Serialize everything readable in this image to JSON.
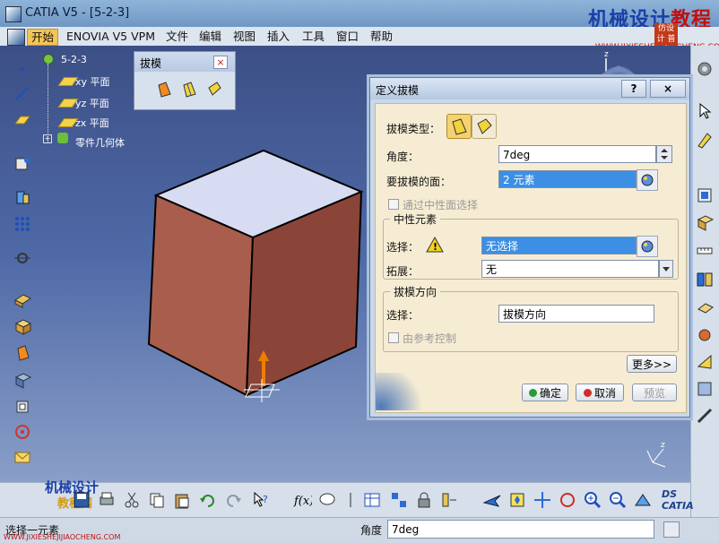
{
  "window": {
    "title": "CATIA V5 - [5-2-3]"
  },
  "watermark": {
    "brand": "机械设计",
    "brand2": "教程网",
    "url": "WWW.JIXIESHEJIJIAOCHENG.COM",
    "stamp": "仿设计\n普大",
    "bottom_brand": "机械设计",
    "bottom_brand2": "教程网",
    "bottom_url": "WWW.JIXIESHEJIJIAOCHENG.COM"
  },
  "menu": {
    "items": [
      "开始",
      "ENOVIA V5 VPM",
      "文件",
      "编辑",
      "视图",
      "插入",
      "工具",
      "窗口",
      "帮助"
    ]
  },
  "tree": {
    "root": "5-2-3",
    "items": [
      "xy 平面",
      "yz 平面",
      "zx 平面",
      "零件几何体"
    ]
  },
  "float_toolbar": {
    "title": "拔模",
    "close": "×"
  },
  "dialog": {
    "title": "定义拔模",
    "help": "?",
    "close": "×",
    "draft_type_label": "拔模类型：",
    "angle_label": "角度：",
    "angle_value": "7deg",
    "faces_label": "要拔模的面：",
    "faces_value": "2 元素",
    "neutral_check": "通过中性面选择",
    "neutral_group": "中性元素",
    "select_label": "选择：",
    "select_value": "无选择",
    "propagation_label": "拓展：",
    "propagation_value": "无",
    "direction_group": "拔模方向",
    "direction_select_label": "选择：",
    "direction_value": "拔模方向",
    "ref_control": "由参考控制",
    "more_button": "更多>>",
    "ok_button": "确定",
    "cancel_button": "取消",
    "preview_button": "预览"
  },
  "status": {
    "left_text": "选择一元素",
    "angle_label": "角度",
    "angle_value": "7deg"
  },
  "colors": {
    "accent": "#f3c457",
    "selection": "#3c8fe4",
    "cube_side": "#a95d4d",
    "cube_top": "#d8dcf2"
  }
}
